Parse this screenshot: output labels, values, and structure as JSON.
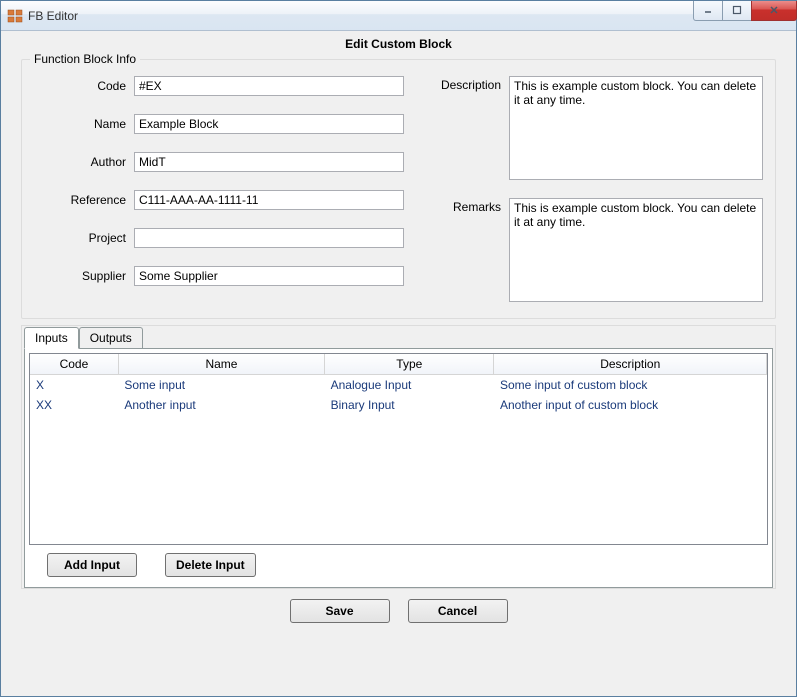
{
  "window": {
    "title": "FB Editor"
  },
  "page": {
    "heading": "Edit Custom Block"
  },
  "fieldset": {
    "legend": "Function Block Info",
    "labels": {
      "code": "Code",
      "name": "Name",
      "author": "Author",
      "reference": "Reference",
      "project": "Project",
      "supplier": "Supplier",
      "description": "Description",
      "remarks": "Remarks"
    },
    "values": {
      "code": "#EX",
      "name": "Example Block",
      "author": "MidT",
      "reference": "C111-AAA-AA-1111-11",
      "project": "",
      "supplier": "Some Supplier",
      "description": "This is example custom block. You can delete it at any time.",
      "remarks": "This is example custom block. You can delete it at any time."
    }
  },
  "tabs": {
    "inputs": "Inputs",
    "outputs": "Outputs",
    "active": "inputs"
  },
  "table": {
    "headers": {
      "code": "Code",
      "name": "Name",
      "type": "Type",
      "description": "Description"
    },
    "rows": [
      {
        "code": "X",
        "name": "Some input",
        "type": "Analogue Input",
        "description": "Some input of custom block"
      },
      {
        "code": "XX",
        "name": "Another input",
        "type": "Binary Input",
        "description": "Another input of custom block"
      }
    ]
  },
  "buttons": {
    "add_input": "Add Input",
    "delete_input": "Delete Input",
    "save": "Save",
    "cancel": "Cancel"
  }
}
